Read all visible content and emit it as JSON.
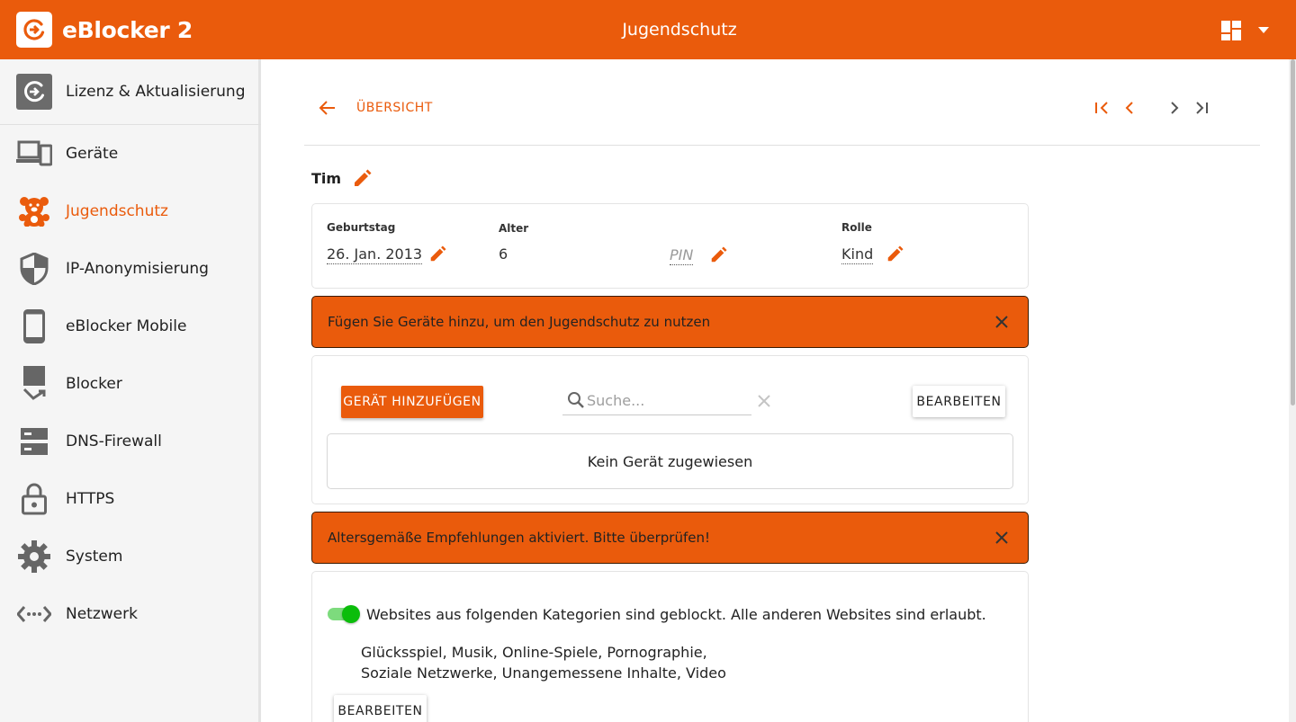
{
  "colors": {
    "accent": "#ea5b0c",
    "toggle_on": "#0bbd0b"
  },
  "header": {
    "brand": "eBlocker 2",
    "title": "Jugendschutz"
  },
  "sidebar": {
    "items": [
      {
        "label": "Lizenz & Aktualisierung",
        "icon": "license-update-icon"
      },
      {
        "label": "Geräte",
        "icon": "devices-icon"
      },
      {
        "label": "Jugendschutz",
        "icon": "teddy-bear-icon",
        "active": true
      },
      {
        "label": "IP-Anonymisierung",
        "icon": "shield-icon"
      },
      {
        "label": "eBlocker Mobile",
        "icon": "phone-icon"
      },
      {
        "label": "Blocker",
        "icon": "blocker-icon"
      },
      {
        "label": "DNS-Firewall",
        "icon": "dns-server-icon"
      },
      {
        "label": "HTTPS",
        "icon": "lock-icon"
      },
      {
        "label": "System",
        "icon": "gear-icon"
      },
      {
        "label": "Netzwerk",
        "icon": "network-icon"
      }
    ]
  },
  "main": {
    "back_label": "ÜBERSICHT",
    "user_name": "Tim",
    "profile": {
      "birthday_label": "Geburtstag",
      "birthday_value": "26. Jan. 2013",
      "age_label": "Alter",
      "age_value": "6",
      "pin_value": "PIN",
      "role_label": "Rolle",
      "role_value": "Kind"
    },
    "alert_devices": "Fügen Sie Geräte hinzu, um den Jugendschutz zu nutzen",
    "devices": {
      "add_button": "GERÄT HINZUFÜGEN",
      "search_placeholder": "Suche...",
      "edit_button": "BEARBEITEN",
      "empty_text": "Kein Gerät zugewiesen"
    },
    "alert_recommend": "Altersgemäße Empfehlungen aktiviert. Bitte überprüfen!",
    "filter": {
      "enabled": true,
      "toggle_text": "Websites aus folgenden Kategorien sind geblockt. Alle anderen Websites sind erlaubt.",
      "categories_line1": "Glücksspiel,  Musik,  Online-Spiele,  Pornographie,",
      "categories_line2": "Soziale Netzwerke,  Unangemessene Inhalte,  Video",
      "edit_button": "BEARBEITEN"
    }
  }
}
